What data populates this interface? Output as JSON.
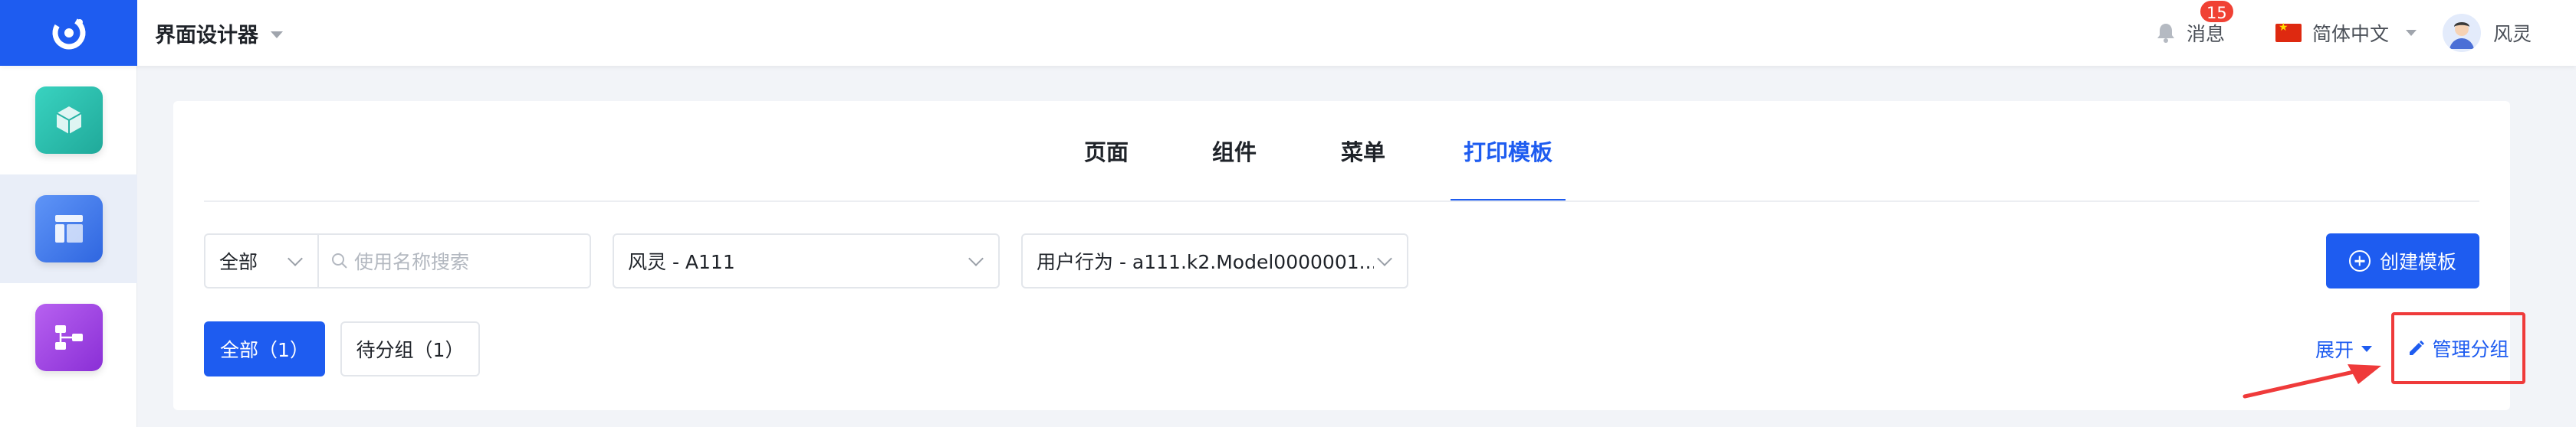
{
  "header": {
    "app_title": "界面设计器",
    "messages_label": "消息",
    "messages_badge": "15",
    "language_label": "简体中文",
    "user_name": "风灵"
  },
  "sidebar": {
    "items": [
      {
        "name": "cube",
        "color": "#2ec4b6"
      },
      {
        "name": "layout",
        "color": "#3d7cf0",
        "active": true
      },
      {
        "name": "flow",
        "color": "#a044e6"
      }
    ]
  },
  "tabs": [
    {
      "label": "页面"
    },
    {
      "label": "组件"
    },
    {
      "label": "菜单"
    },
    {
      "label": "打印模板",
      "active": true
    }
  ],
  "filters": {
    "scope_select": "全部",
    "search_placeholder": "使用名称搜索",
    "app_select": "风灵 - A111",
    "model_select": "用户行为 - a111.k2.Model0000001..."
  },
  "actions": {
    "create_label": "创建模板",
    "expand_label": "展开",
    "manage_label": "管理分组"
  },
  "groups": [
    {
      "label": "全部（1）",
      "selected": true
    },
    {
      "label": "待分组（1）",
      "selected": false
    }
  ],
  "colors": {
    "primary": "#1e5cf0",
    "annotation": "#ef3a3a",
    "badge": "#f04134"
  }
}
